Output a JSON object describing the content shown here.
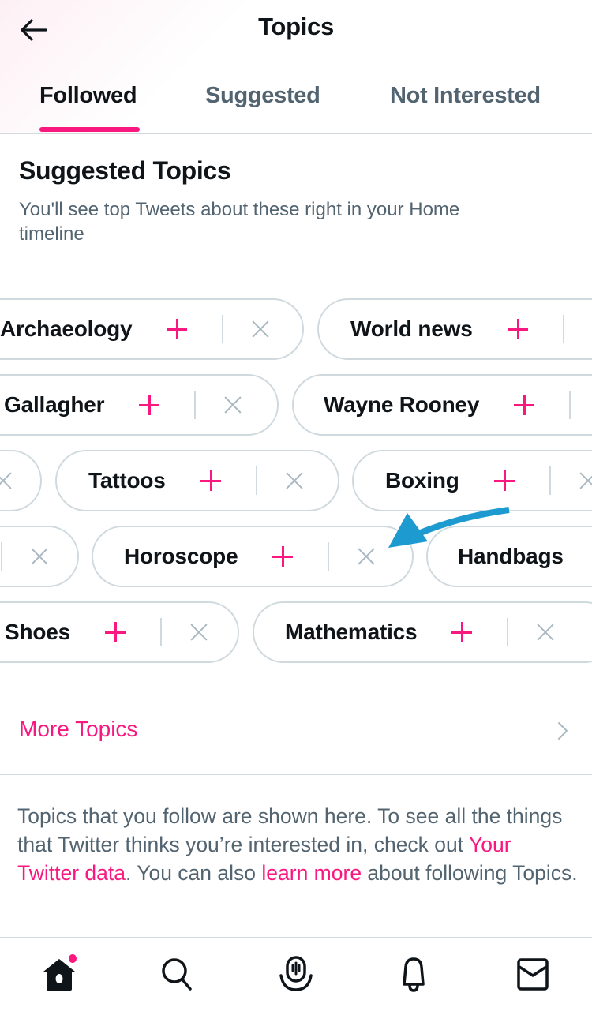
{
  "colors": {
    "accent": "#f91880",
    "annotation_arrow": "#1d9bd1",
    "text_primary": "#0f1419",
    "text_secondary": "#536471"
  },
  "header": {
    "back_icon": "arrow-left-icon",
    "title": "Topics",
    "tabs": [
      {
        "label": "Followed",
        "active": true
      },
      {
        "label": "Suggested",
        "active": false
      },
      {
        "label": "Not Interested",
        "active": false
      }
    ]
  },
  "suggested": {
    "title": "Suggested Topics",
    "subtitle": "You'll see top Tweets about these right in your Home timeline",
    "rows": [
      {
        "chips": [
          {
            "label": "Archaeology",
            "add_icon": "plus-icon",
            "dismiss_icon": "close-icon"
          },
          {
            "label": "World news",
            "add_icon": "plus-icon",
            "dismiss_icon": "close-icon"
          }
        ]
      },
      {
        "chips": [
          {
            "label": "Gallagher",
            "add_icon": "plus-icon",
            "dismiss_icon": "close-icon"
          },
          {
            "label": "Wayne Rooney",
            "add_icon": "plus-icon",
            "dismiss_icon": "close-icon"
          }
        ]
      },
      {
        "chips": [
          {
            "label": "",
            "add_icon": "",
            "dismiss_icon": "close-icon"
          },
          {
            "label": "Tattoos",
            "add_icon": "plus-icon",
            "dismiss_icon": "close-icon"
          },
          {
            "label": "Boxing",
            "add_icon": "plus-icon",
            "dismiss_icon": "close-icon"
          }
        ]
      },
      {
        "chips": [
          {
            "label": "",
            "add_icon": "",
            "dismiss_icon": "close-icon"
          },
          {
            "label": "Horoscope",
            "add_icon": "plus-icon",
            "dismiss_icon": "close-icon"
          },
          {
            "label": "Handbags",
            "add_icon": "plus-icon",
            "dismiss_icon": "close-icon"
          }
        ]
      },
      {
        "chips": [
          {
            "label": "Shoes",
            "add_icon": "plus-icon",
            "dismiss_icon": "close-icon"
          },
          {
            "label": "Mathematics",
            "add_icon": "plus-icon",
            "dismiss_icon": "close-icon"
          }
        ]
      }
    ],
    "annotation": "arrow pointing to Horoscope dismiss button"
  },
  "more_topics": {
    "label": "More Topics",
    "icon": "chevron-right-icon"
  },
  "info": {
    "text_1": "Topics that you follow are shown here. To see all the things that Twitter thinks you’re interested in, check out ",
    "link_1": "Your Twitter data",
    "text_2": ". You can also ",
    "link_2": "learn more",
    "text_3": " about following Topics."
  },
  "bottom_nav": {
    "items": [
      {
        "name": "home",
        "icon": "home-icon",
        "has_notification_dot": true
      },
      {
        "name": "search",
        "icon": "search-icon"
      },
      {
        "name": "spaces",
        "icon": "spaces-icon"
      },
      {
        "name": "notifications",
        "icon": "bell-icon"
      },
      {
        "name": "messages",
        "icon": "mail-icon"
      }
    ]
  }
}
